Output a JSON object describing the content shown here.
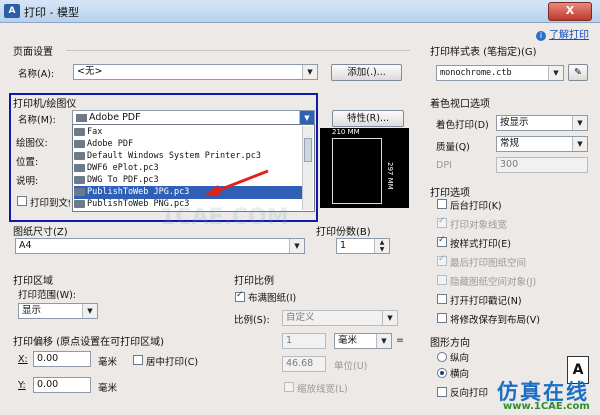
{
  "window": {
    "title": "打印 - 模型",
    "app_icon": "A",
    "close_symbol": "X",
    "help_link": "了解打印"
  },
  "page_setup": {
    "section": "页面设置",
    "name_label": "名称(A):",
    "name_value": "<无>",
    "add_button": "添加(.)..."
  },
  "printer": {
    "section": "打印机/绘图仪",
    "name_label": "名称(M):",
    "name_value": "Adobe PDF",
    "properties_button": "特性(R)...",
    "plotter_label": "绘图仪:",
    "location_label": "位置:",
    "description_label": "说明:",
    "print_to_file_label": "打印到文件",
    "dropdown_items": [
      "Fax",
      "Adobe PDF",
      "Default Windows System Printer.pc3",
      "DWF6 ePlot.pc3",
      "DWG To PDF.pc3",
      "PublishToWeb JPG.pc3",
      "PublishToWeb PNG.pc3"
    ],
    "selected_item": "PublishToWeb JPG.pc3",
    "preview_width": "210 MM",
    "preview_height": "297 MM"
  },
  "paper": {
    "section": "图纸尺寸(Z)",
    "value": "A4",
    "copies_label": "打印份数(B)",
    "copies_value": "1"
  },
  "plot_area": {
    "section": "打印区域",
    "range_label": "打印范围(W):",
    "range_value": "显示"
  },
  "plot_scale": {
    "section": "打印比例",
    "fit_label": "布满图纸(I)",
    "scale_label": "比例(S):",
    "scale_value": "自定义",
    "value1": "1",
    "unit": "毫米",
    "eq": "=",
    "value2": "46.68",
    "unit2_label": "单位(U)",
    "lineweights_label": "缩放线宽(L)"
  },
  "plot_offset": {
    "section": "打印偏移 (原点设置在可打印区域)",
    "x_label": "X:",
    "x_value": "0.00",
    "x_unit": "毫米",
    "center_label": "居中打印(C)",
    "y_label": "Y:",
    "y_value": "0.00",
    "y_unit": "毫米"
  },
  "plot_style": {
    "section": "打印样式表 (笔指定)(G)",
    "value": "monochrome.ctb"
  },
  "shaded": {
    "section": "着色视口选项",
    "shade_label": "着色打印(D)",
    "shade_value": "按显示",
    "quality_label": "质量(Q)",
    "quality_value": "常规",
    "dpi_label": "DPI",
    "dpi_value": "300"
  },
  "options": {
    "section": "打印选项",
    "items": [
      {
        "label": "后台打印(K)",
        "checked": false,
        "disabled": false
      },
      {
        "label": "打印对象线宽",
        "checked": true,
        "disabled": true
      },
      {
        "label": "按样式打印(E)",
        "checked": true,
        "disabled": false
      },
      {
        "label": "最后打印图纸空间",
        "checked": true,
        "disabled": true
      },
      {
        "label": "隐藏图纸空间对象(J)",
        "checked": false,
        "disabled": true
      },
      {
        "label": "打开打印戳记(N)",
        "checked": false,
        "disabled": false
      },
      {
        "label": "将修改保存到布局(V)",
        "checked": false,
        "disabled": false
      }
    ]
  },
  "orientation": {
    "section": "图形方向",
    "portrait": "纵向",
    "landscape": "横向",
    "upside_down": "反向打印"
  },
  "watermark": {
    "text1": "仿真在线",
    "text2": "www.1CAE.com",
    "faint": "1CAE.COM"
  },
  "colors": {
    "highlight_box": "#0d1aa8",
    "selection": "#2f5fb7",
    "arrow": "#e0221b",
    "watermark_blue": "#1a6fc4",
    "watermark_green": "#2c8f2c"
  }
}
